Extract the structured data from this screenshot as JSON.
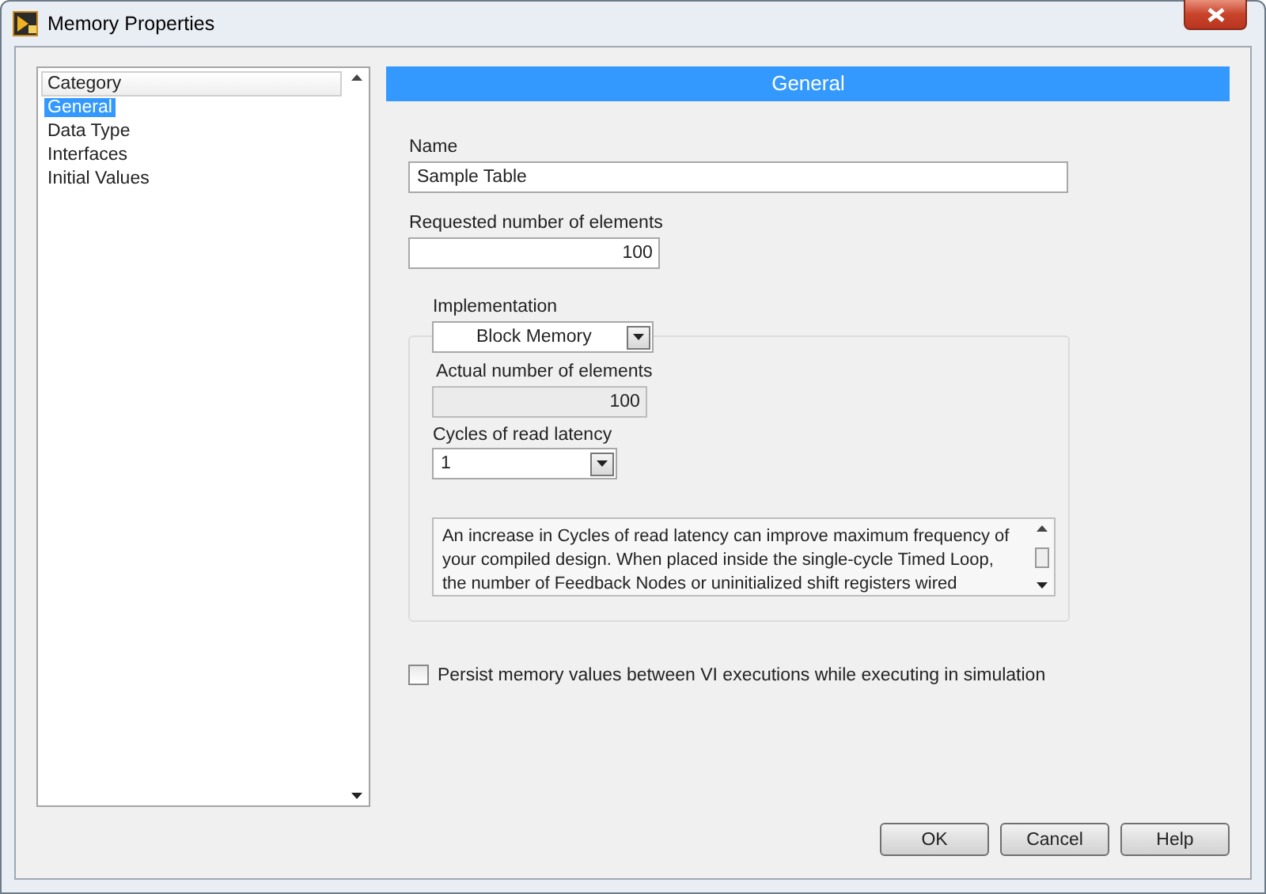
{
  "window": {
    "title": "Memory Properties"
  },
  "category_list": {
    "header": "Category",
    "items": [
      {
        "label": "General",
        "selected": true
      },
      {
        "label": "Data Type",
        "selected": false
      },
      {
        "label": "Interfaces",
        "selected": false
      },
      {
        "label": "Initial Values",
        "selected": false
      }
    ]
  },
  "section_header": "General",
  "name_field": {
    "label": "Name",
    "value": "Sample Table"
  },
  "requested_elements": {
    "label": "Requested number of elements",
    "value": "100"
  },
  "implementation": {
    "label": "Implementation",
    "value": "Block Memory"
  },
  "actual_elements": {
    "label": "Actual number of elements",
    "value": "100",
    "disabled": true
  },
  "read_latency": {
    "label": "Cycles of read latency",
    "value": "1"
  },
  "description": "An increase in Cycles of read latency can improve maximum frequency of your compiled design. When placed inside the single-cycle Timed Loop, the number of Feedback Nodes or uninitialized shift registers wired",
  "persist_checkbox": {
    "label": "Persist memory values between VI executions while executing in simulation",
    "checked": false
  },
  "buttons": [
    {
      "label": "OK"
    },
    {
      "label": "Cancel"
    },
    {
      "label": "Help"
    }
  ]
}
